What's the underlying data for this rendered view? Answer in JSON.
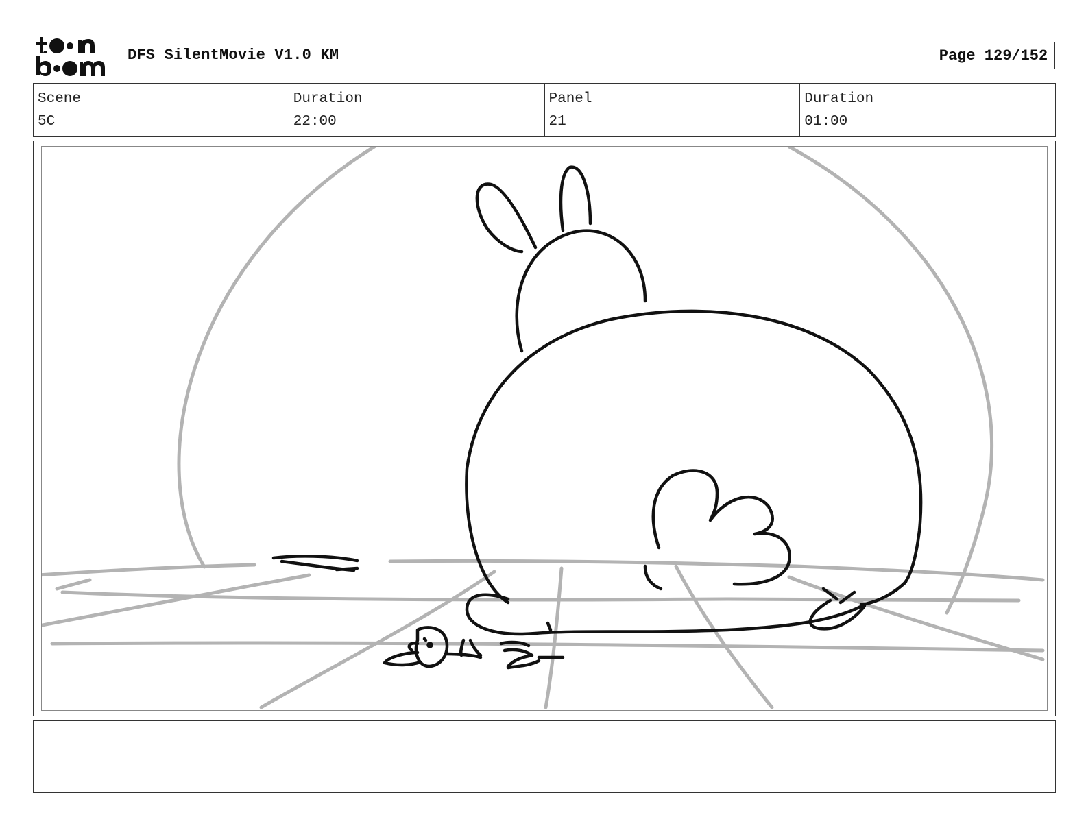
{
  "header": {
    "logo_text": "toon boom",
    "doc_title": "DFS SilentMovie V1.0 KM",
    "page_label": "Page 129/152"
  },
  "info": {
    "scene_label": "Scene",
    "scene_value": "5C",
    "scene_duration_label": "Duration",
    "scene_duration_value": "22:00",
    "panel_label": "Panel",
    "panel_value": "21",
    "panel_duration_label": "Duration",
    "panel_duration_value": "01:00"
  },
  "panel_image": {
    "description_icon": "storyboard-sketch-rabbit",
    "line_color": "#111111",
    "guide_color": "#b0b0b0"
  },
  "notes": {
    "text": ""
  }
}
